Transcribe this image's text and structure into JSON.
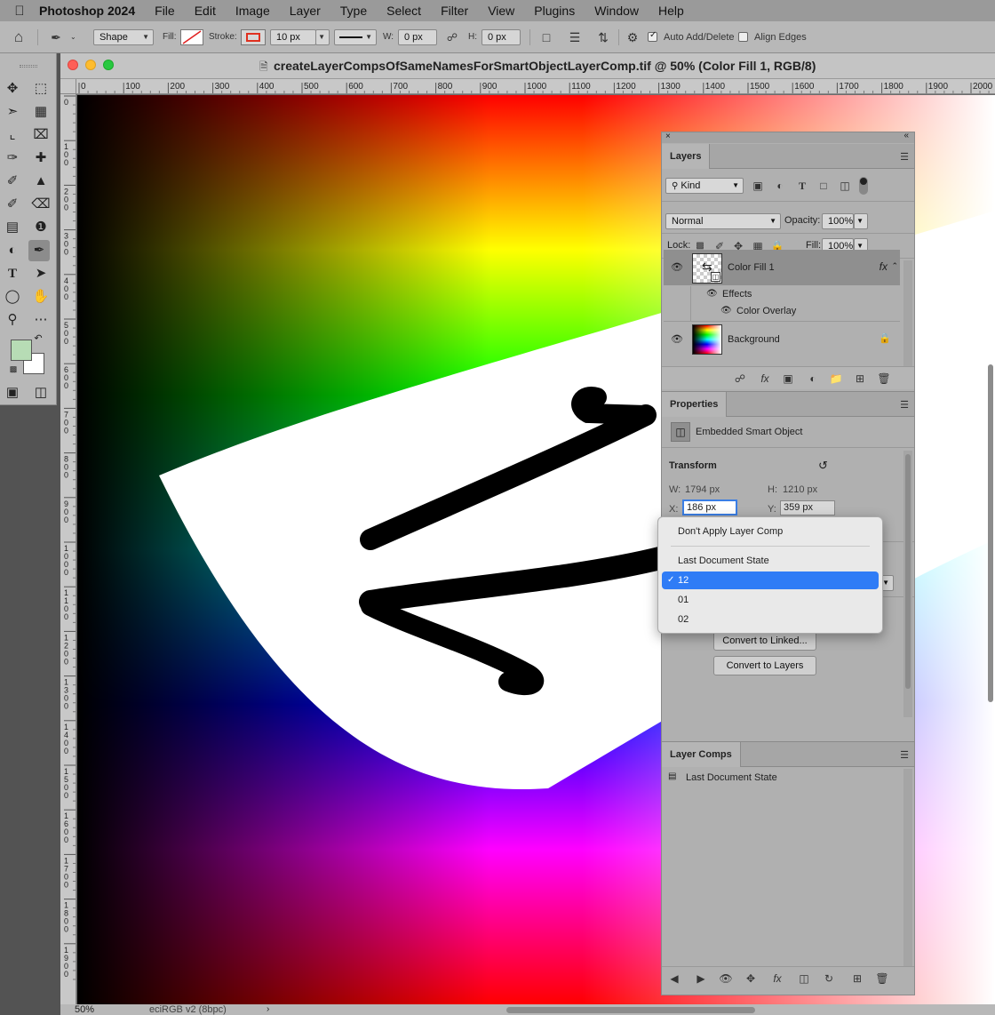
{
  "menubar": {
    "app_name": "Photoshop 2024",
    "items": [
      "File",
      "Edit",
      "Image",
      "Layer",
      "Type",
      "Select",
      "Filter",
      "View",
      "Plugins",
      "Window",
      "Help"
    ]
  },
  "options": {
    "mode": "Shape",
    "fill_label": "Fill:",
    "stroke_label": "Stroke:",
    "stroke_width": "10 px",
    "w_label": "W:",
    "w_value": "0 px",
    "h_label": "H:",
    "h_value": "0 px",
    "auto_add_delete": "Auto Add/Delete",
    "auto_add_delete_checked": true,
    "align_edges": "Align Edges",
    "align_edges_checked": false
  },
  "tools": {
    "foreground_color": "#b7dcb5",
    "background_color": "#ffffff",
    "active": "pen-tool"
  },
  "document": {
    "title": "createLayerCompsOfSameNamesForSmartObjectLayerComp.tif @ 50% (Color Fill 1, RGB/8)",
    "zoom": "50%",
    "color_profile": "eciRGB v2 (8bpc)",
    "ruler_h_ticks": [
      "0",
      "100",
      "200",
      "300",
      "400",
      "500",
      "600",
      "700",
      "800",
      "900",
      "1000",
      "1100",
      "1200",
      "1300",
      "1400",
      "1500",
      "1600",
      "1700",
      "1800",
      "1900",
      "2000"
    ],
    "ruler_v_ticks": [
      "0",
      "100",
      "200",
      "300",
      "400",
      "500",
      "600",
      "700",
      "800",
      "900",
      "1000",
      "1100",
      "1200",
      "1300",
      "1400",
      "1500",
      "1600",
      "1700",
      "1800",
      "1900"
    ]
  },
  "layers_panel": {
    "tab": "Layers",
    "filter_kind": "Kind",
    "blend_mode": "Normal",
    "opacity_label": "Opacity:",
    "opacity": "100%",
    "lock_label": "Lock:",
    "fill_label": "Fill:",
    "fill": "100%",
    "layers": [
      {
        "name": "Color Fill 1",
        "selected": true,
        "fx": "fx"
      },
      {
        "name": "Background",
        "selected": false,
        "locked": true
      }
    ],
    "effects_label": "Effects",
    "effect_item": "Color Overlay"
  },
  "properties_panel": {
    "tab": "Properties",
    "object_type": "Embedded Smart Object",
    "transform_label": "Transform",
    "w_label": "W:",
    "w_value": "1794 px",
    "h_label": "H:",
    "h_value": "1210 px",
    "x_label": "X:",
    "x_value": "186 px",
    "y_label": "Y:",
    "y_value": "359 px",
    "convert_linked": "Convert to Linked...",
    "convert_layers": "Convert to Layers"
  },
  "layer_comp_menu": {
    "options": [
      "Don't Apply Layer Comp",
      "Last Document State",
      "12",
      "01",
      "02"
    ],
    "selected": "12"
  },
  "layer_comps_panel": {
    "tab": "Layer Comps",
    "items": [
      "Last Document State"
    ]
  }
}
